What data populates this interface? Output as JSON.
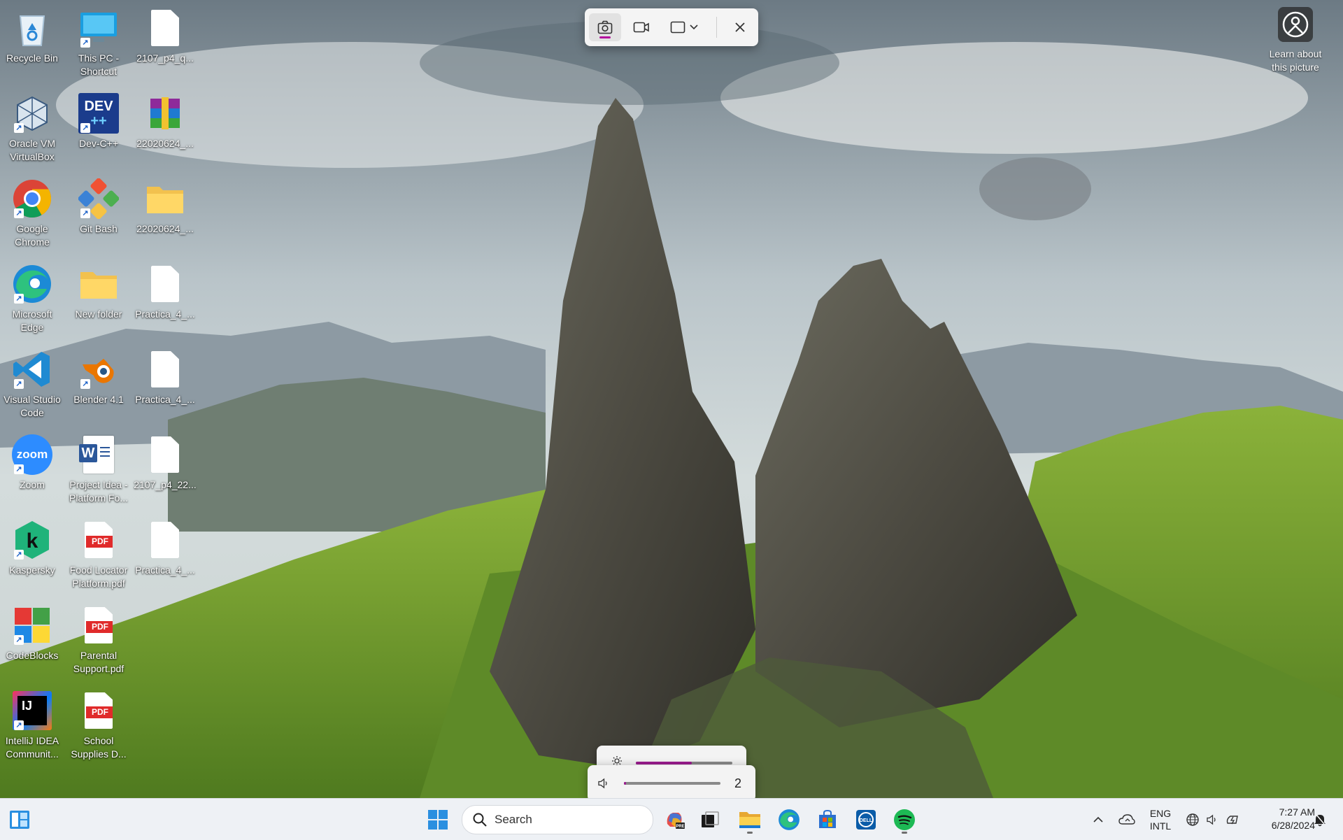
{
  "desktop": {
    "icons": [
      {
        "label": "Recycle Bin",
        "icon": "recycle-bin-icon"
      },
      {
        "label": "This PC -\nShortcut",
        "icon": "this-pc-icon"
      },
      {
        "label": "2107_p4_q...",
        "icon": "file-icon"
      },
      {
        "label": "Oracle VM\nVirtualBox",
        "icon": "virtualbox-icon"
      },
      {
        "label": "Dev-C++",
        "icon": "devcpp-icon",
        "badge": "DEV"
      },
      {
        "label": "22020624_...",
        "icon": "winrar-archive-icon"
      },
      {
        "label": "Google\nChrome",
        "icon": "chrome-icon"
      },
      {
        "label": "Git Bash",
        "icon": "git-bash-icon"
      },
      {
        "label": "22020624_...",
        "icon": "folder-icon"
      },
      {
        "label": "Microsoft\nEdge",
        "icon": "edge-icon"
      },
      {
        "label": "New folder",
        "icon": "folder-icon"
      },
      {
        "label": "Practica_4_...",
        "icon": "file-icon"
      },
      {
        "label": "Visual Studio\nCode",
        "icon": "vscode-icon"
      },
      {
        "label": "Blender 4.1",
        "icon": "blender-icon"
      },
      {
        "label": "Practica_4_...",
        "icon": "file-icon"
      },
      {
        "label": "Zoom",
        "icon": "zoom-icon",
        "badge": "zoom"
      },
      {
        "label": "Project Idea -\nPlatform Fo...",
        "icon": "word-doc-icon",
        "badge": "W"
      },
      {
        "label": "2107_p4_22...",
        "icon": "file-icon"
      },
      {
        "label": "Kaspersky",
        "icon": "kaspersky-icon",
        "badge": "k"
      },
      {
        "label": "Food Locator\nPlatform.pdf",
        "icon": "pdf-icon",
        "badge": "PDF"
      },
      {
        "label": "Practica_4_...",
        "icon": "file-icon"
      },
      {
        "label": "CodeBlocks",
        "icon": "codeblocks-icon"
      },
      {
        "label": "Parental\nSupport.pdf",
        "icon": "pdf-icon",
        "badge": "PDF"
      },
      {
        "label": "IntelliJ IDEA\nCommunit...",
        "icon": "intellij-icon",
        "badge": "IJ"
      },
      {
        "label": "School\nSupplies D...",
        "icon": "pdf-icon",
        "badge": "PDF"
      }
    ]
  },
  "snipping_toolbar": {
    "modes": [
      "screenshot-mode",
      "video-mode",
      "rectangle-shape"
    ],
    "close_label": "close"
  },
  "learn_picture": {
    "label": "Learn about\nthis picture"
  },
  "flyout": {
    "brightness": 0.58,
    "volume": 0.02,
    "volume_label": "2"
  },
  "taskbar": {
    "search_placeholder": "Search",
    "apps": [
      "copilot-icon",
      "task-view-icon",
      "file-explorer-icon",
      "edge-icon",
      "store-icon",
      "dell-icon",
      "spotify-icon"
    ],
    "language_top": "ENG",
    "language_bottom": "INTL",
    "time": "7:27 AM",
    "date": "6/28/2024"
  },
  "colors": {
    "accent": "#9b1c8f",
    "taskbar_bg": "#eef1f5"
  }
}
